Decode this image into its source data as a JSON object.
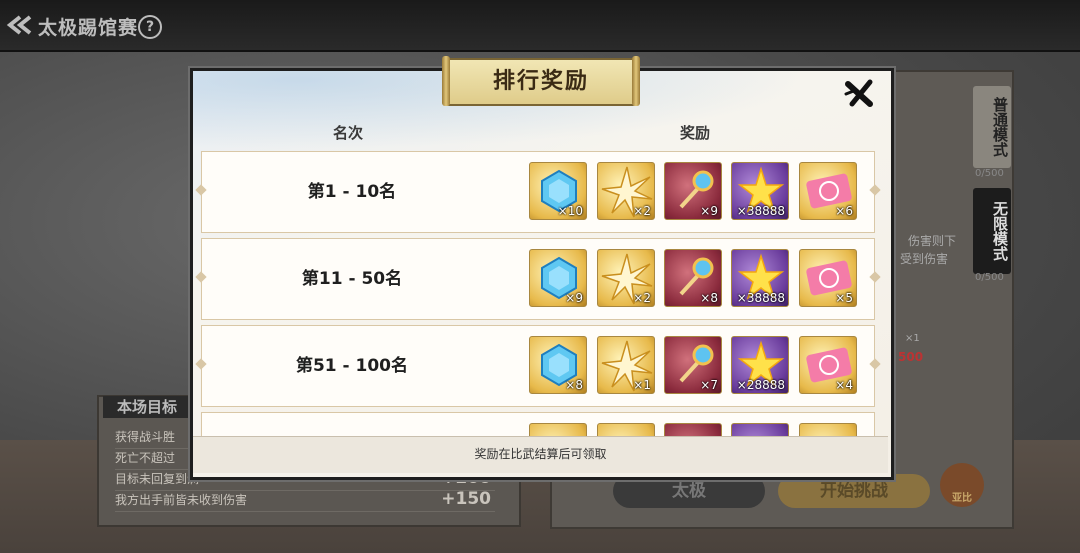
{
  "header": {
    "title": "太极踢馆赛"
  },
  "modes": [
    {
      "label": "普通模式",
      "count": "0/500"
    },
    {
      "label": "无限模式",
      "count": "0/500"
    }
  ],
  "side_texts": [
    "伤害则下",
    "受到伤害",
    "500",
    "×1"
  ],
  "goals": {
    "title": "本场目标",
    "rows": [
      {
        "label": "获得战斗胜",
        "points": ""
      },
      {
        "label": "死亡不超过",
        "points": ""
      },
      {
        "label": "目标未回复到满",
        "points": "+200"
      },
      {
        "label": "我方出手前皆未收到伤害",
        "points": "+150"
      }
    ]
  },
  "buttons": {
    "style": "太极",
    "start": "开始挑战",
    "avatar": "亚比"
  },
  "dialog": {
    "title": "排行奖励",
    "col_rank": "名次",
    "col_reward": "奖励",
    "footer": "奖励在比武结算后可领取",
    "rows": [
      {
        "rank": "第1 - 10名",
        "items": [
          {
            "icon": "blue-gem-icon",
            "qty": "×10"
          },
          {
            "icon": "gold-star-badge-icon",
            "qty": "×2"
          },
          {
            "icon": "magic-wand-icon",
            "qty": "×9"
          },
          {
            "icon": "yellow-star-icon",
            "qty": "×38888"
          },
          {
            "icon": "ferris-ticket-icon",
            "qty": "×6"
          }
        ]
      },
      {
        "rank": "第11 - 50名",
        "items": [
          {
            "icon": "blue-gem-icon",
            "qty": "×9"
          },
          {
            "icon": "gold-star-badge-icon",
            "qty": "×2"
          },
          {
            "icon": "magic-wand-icon",
            "qty": "×8"
          },
          {
            "icon": "yellow-star-icon",
            "qty": "×38888"
          },
          {
            "icon": "ferris-ticket-icon",
            "qty": "×5"
          }
        ]
      },
      {
        "rank": "第51 - 100名",
        "items": [
          {
            "icon": "blue-gem-icon",
            "qty": "×8"
          },
          {
            "icon": "gold-star-badge-icon",
            "qty": "×1"
          },
          {
            "icon": "magic-wand-icon",
            "qty": "×7"
          },
          {
            "icon": "yellow-star-icon",
            "qty": "×28888"
          },
          {
            "icon": "ferris-ticket-icon",
            "qty": "×4"
          }
        ]
      }
    ]
  }
}
